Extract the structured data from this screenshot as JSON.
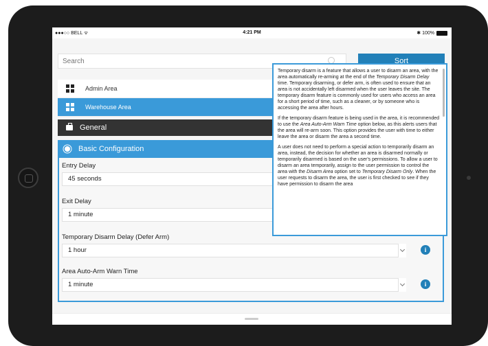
{
  "status_bar": {
    "carrier": "●●●○○ BELL ᯤ",
    "time": "4:21 PM",
    "battery": "✱ 100%"
  },
  "search": {
    "placeholder": "Search"
  },
  "sort_label": "Sort",
  "areas": [
    {
      "label": "Admin Area",
      "selected": false
    },
    {
      "label": "Warehouse Area",
      "selected": true
    }
  ],
  "sections": {
    "general": "General",
    "basic": "Basic Configuration"
  },
  "fields": [
    {
      "label": "Entry Delay",
      "value": "45 seconds"
    },
    {
      "label": "Exit Delay",
      "value": "1 minute"
    },
    {
      "label": "Temporary Disarm Delay (Defer Arm)",
      "value": "1 hour"
    },
    {
      "label": "Area Auto-Arm Warn Time",
      "value": "1 minute"
    }
  ],
  "info_glyph": "i",
  "tooltip": {
    "p1_a": "Temporary disarm is a feature that allows a user to disarm an area, with the area automatically re-arming at the end of the ",
    "p1_em": "Temporary Disarm Delay",
    "p1_b": " time. Temporary disarming, or defer arm, is often used to ensure that an area is not accidentally left disarmed when the user leaves the site. The temporary disarm feature is commonly used for users who access an area for a short period of time, such as a cleaner, or by someone who is accessing the area after hours.",
    "p2_a": "If the temporary disarm feature is being used in the area, it is recommended to use the ",
    "p2_em": "Area Auto-Arm Warn Time",
    "p2_b": " option below, as this alerts users that the area will re-arm soon. This option provides the user with time to either leave the area or disarm the area a second time.",
    "p3_a": "A user does not need to perform a special action to temporarily disarm an area, instead, the decision for whether an area is disarmed normally or temporarily disarmed is based on the user's permissions. To allow a user to disarm an area temporarily, assign to the user permission to control the area with the ",
    "p3_em1": "Disarm Area",
    "p3_b": " option set to ",
    "p3_em2": "Temporary Disarm Only",
    "p3_c": ". When the user requests to disarm the area, the user is first checked to see if they have permission to disarm the area"
  },
  "colors": {
    "accent": "#3a9ad9",
    "sort_button": "#2280b8",
    "general_header": "#333333"
  }
}
